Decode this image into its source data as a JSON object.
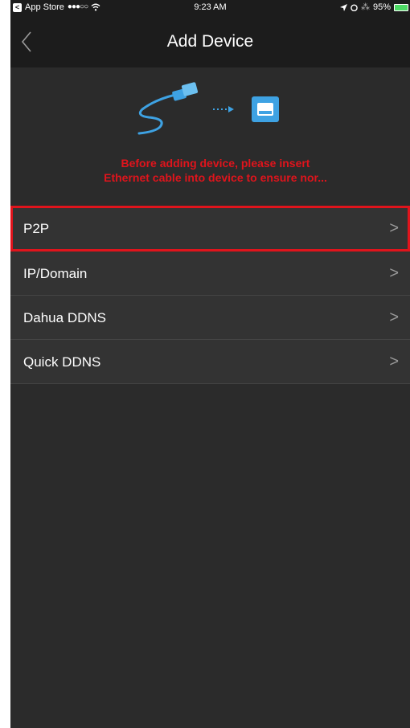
{
  "status_bar": {
    "back_app": "App Store",
    "signal": "●●●○○",
    "time": "9:23 AM",
    "battery": "95%"
  },
  "nav": {
    "title": "Add Device",
    "back_icon": "chevron-left-icon"
  },
  "hint": {
    "line1": "Before adding device, please insert",
    "line2": "Ethernet cable into device to ensure nor..."
  },
  "menu": {
    "items": [
      {
        "label": "P2P",
        "selected": true
      },
      {
        "label": "IP/Domain",
        "selected": false
      },
      {
        "label": "Dahua DDNS",
        "selected": false
      },
      {
        "label": "Quick DDNS",
        "selected": false
      }
    ],
    "chevron": ">"
  },
  "colors": {
    "background": "#2b2b2b",
    "nav_background": "#1c1c1c",
    "hint_text": "#e0141c",
    "highlight_border": "#e0141c",
    "icon_blue": "#3ea2e3"
  }
}
